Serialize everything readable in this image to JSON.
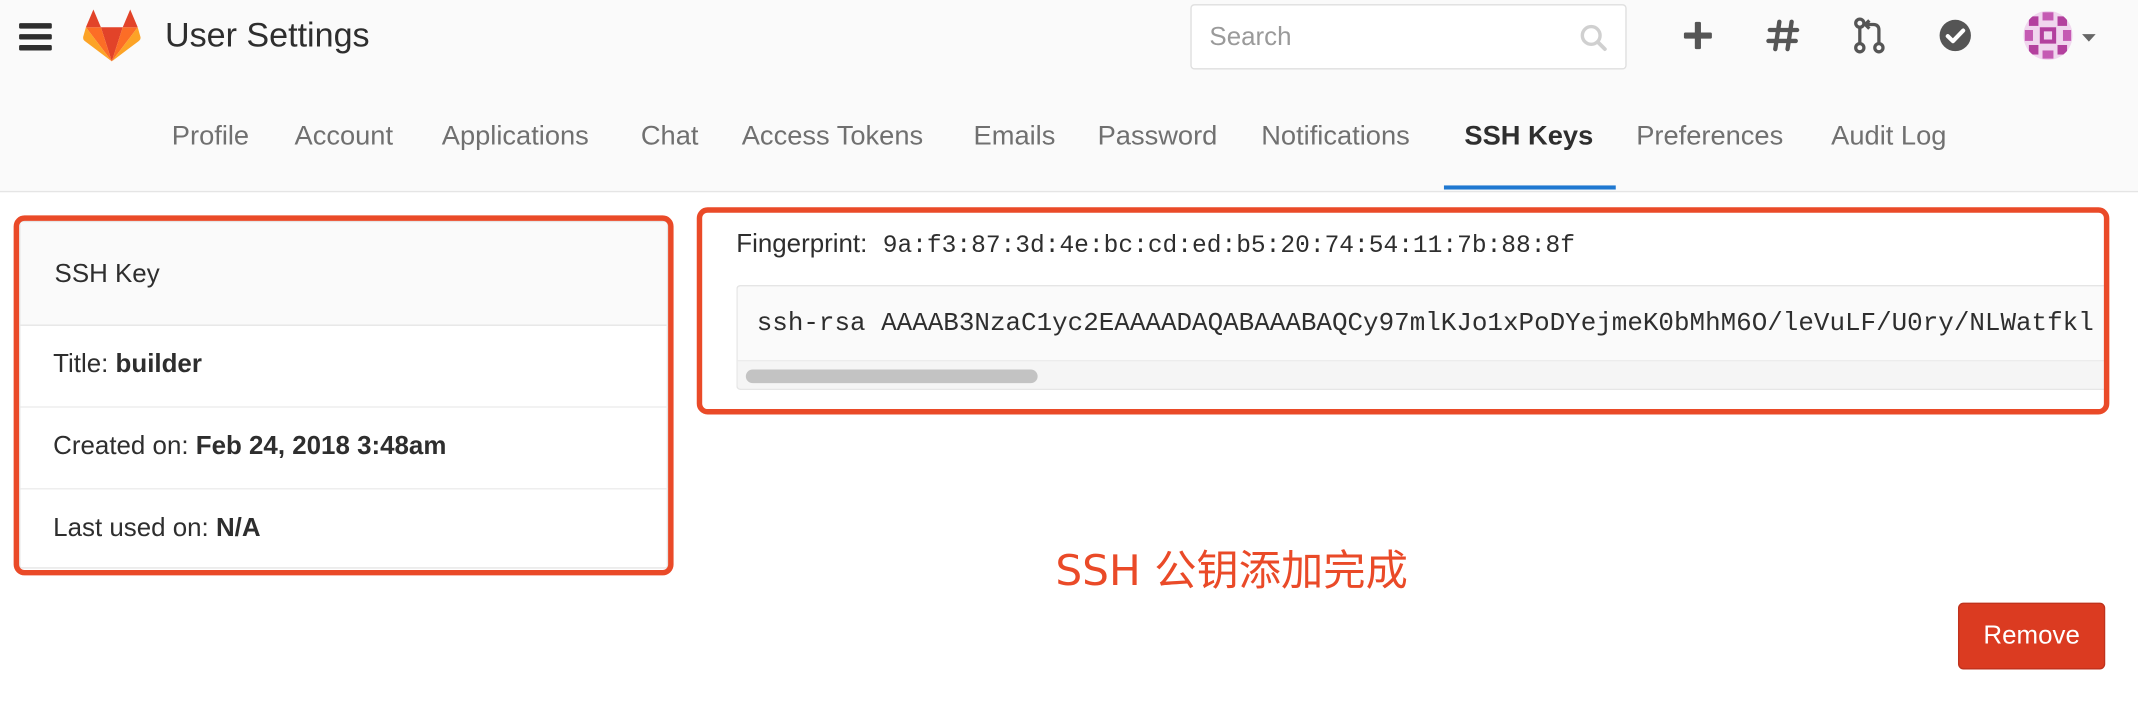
{
  "header": {
    "title": "User Settings",
    "search_placeholder": "Search",
    "icons": [
      "menu-icon",
      "gitlab-logo",
      "search-icon",
      "plus-icon",
      "hash-icon",
      "merge-request-icon",
      "todo-check-icon",
      "avatar",
      "chevron-down-icon"
    ]
  },
  "tabs": [
    {
      "label": "Profile"
    },
    {
      "label": "Account"
    },
    {
      "label": "Applications"
    },
    {
      "label": "Chat"
    },
    {
      "label": "Access Tokens"
    },
    {
      "label": "Emails"
    },
    {
      "label": "Password"
    },
    {
      "label": "Notifications"
    },
    {
      "label": "SSH Keys",
      "active": true
    },
    {
      "label": "Preferences"
    },
    {
      "label": "Audit Log"
    }
  ],
  "key_card": {
    "header": "SSH Key",
    "title_label": "Title:",
    "title_value": "builder",
    "created_label": "Created on:",
    "created_value": "Feb 24, 2018 3:48am",
    "last_used_label": "Last used on:",
    "last_used_value": "N/A"
  },
  "key_detail": {
    "fingerprint_label": "Fingerprint:",
    "fingerprint_value": "9a:f3:87:3d:4e:bc:cd:ed:b5:20:74:54:11:7b:88:8f",
    "public_key": "ssh-rsa AAAAB3NzaC1yc2EAAAADAQABAAABAQCy97mlKJo1xPoDYejmeK0bMhM6O/leVuLF/U0ry/NLWatfkl"
  },
  "annotation": "SSH 公钥添加完成",
  "actions": {
    "remove_label": "Remove"
  },
  "colors": {
    "accent_blue": "#1f78d1",
    "danger": "#db3b21",
    "annotation_red": "#ea4a28",
    "header_bg": "#fafafa"
  }
}
